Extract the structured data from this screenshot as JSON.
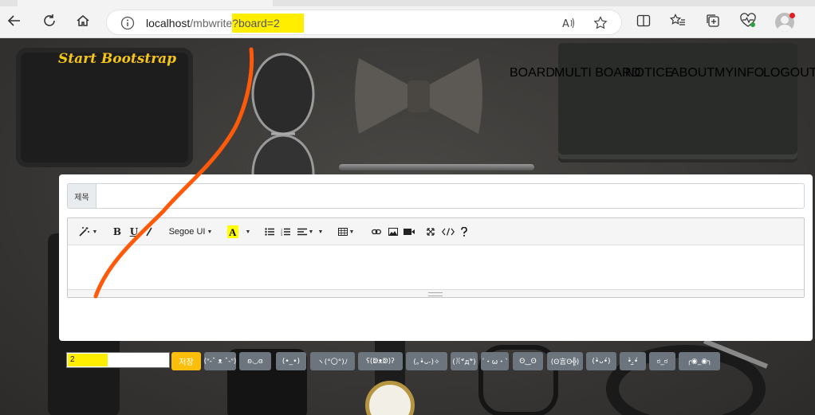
{
  "browser": {
    "url_host": "localhost",
    "url_path": "/mbwrite",
    "url_query": "?board=2"
  },
  "site": {
    "brand": "Start Bootstrap",
    "nav": [
      "BOARD",
      "MULTI BOARD",
      "NOTICE",
      "ABOUT",
      "MYINFO",
      "LOGOUT"
    ]
  },
  "form": {
    "title_label": "제목",
    "title_value": "",
    "board_value": "2",
    "save_label": "저장",
    "emoticons": [
      "(ᐡ-ˆ ᴥ ˆ-ᐡ)",
      "ʚ◡ɞ",
      "(•_•)",
      "ヽ(°〇°)ﾉ",
      "ʕ(ↁᴥↁ)ʔ",
      "(｡•̀ᴗ-)✧",
      "(ꐦ°᷄д°᷅)",
      "(´・ω・`)",
      "ʘ‿ʘ",
      "(ʘ言ʘ╬)",
      "(•̀ᴗ•́)",
      "•̀.̫•́",
      "ಠ_ಠ",
      "╭◉_◉╮"
    ]
  },
  "editor": {
    "font_name": "Segoe UI"
  },
  "colors": {
    "brand": "#f5c518",
    "save_button": "#fbbf0b",
    "emoticon_button": "#6c757d",
    "highlight": "#ffee00",
    "annotation_stroke": "#ff5a0a"
  }
}
